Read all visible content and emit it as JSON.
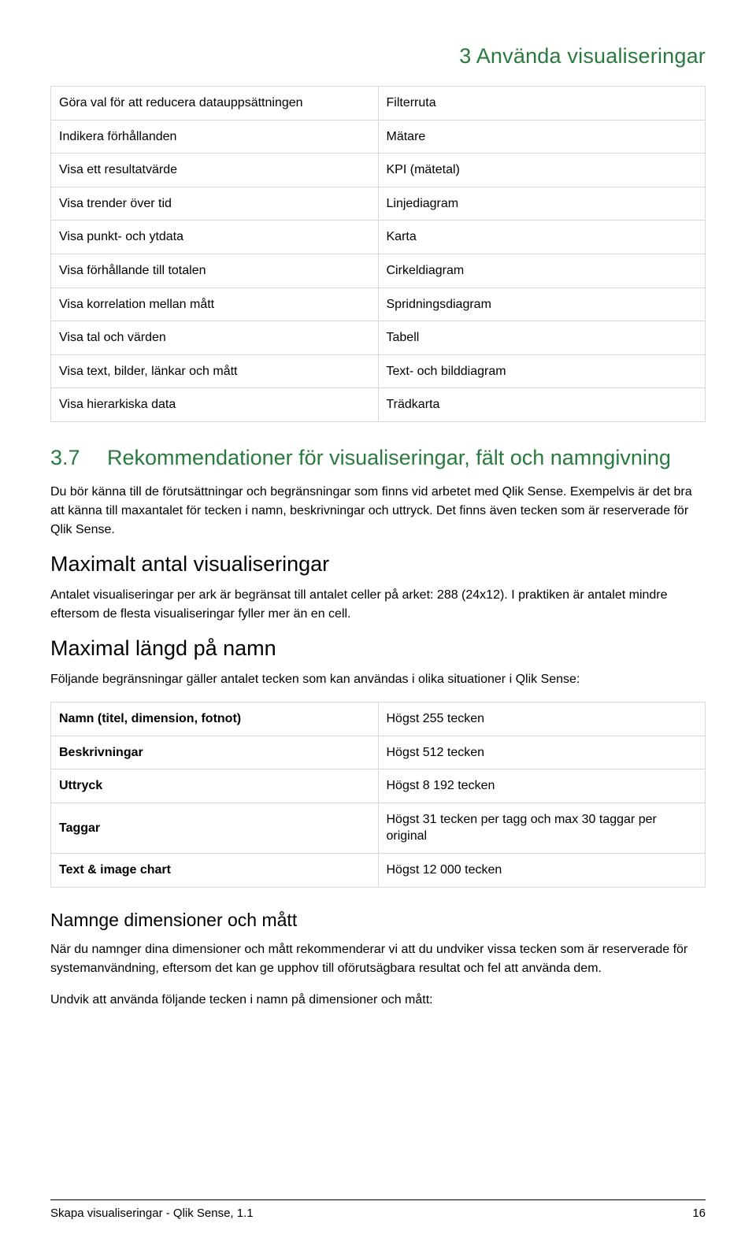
{
  "chapter_header": "3  Använda visualiseringar",
  "table1": {
    "rows": [
      {
        "left": "Göra val för att reducera datauppsättningen",
        "right": "Filterruta"
      },
      {
        "left": "Indikera förhållanden",
        "right": "Mätare"
      },
      {
        "left": "Visa ett resultatvärde",
        "right": "KPI (mätetal)"
      },
      {
        "left": "Visa trender över tid",
        "right": "Linjediagram"
      },
      {
        "left": "Visa punkt- och ytdata",
        "right": "Karta"
      },
      {
        "left": "Visa förhållande till totalen",
        "right": "Cirkeldiagram"
      },
      {
        "left": "Visa korrelation mellan mått",
        "right": "Spridningsdiagram"
      },
      {
        "left": "Visa tal och värden",
        "right": "Tabell"
      },
      {
        "left": "Visa text, bilder, länkar och mått",
        "right": "Text- och bilddiagram"
      },
      {
        "left": "Visa hierarkiska data",
        "right": "Trädkarta"
      }
    ]
  },
  "section_3_7": {
    "number": "3.7",
    "title": "Rekommendationer för visualiseringar, fält och namngivning",
    "para": "Du bör känna till de förutsättningar och begränsningar som finns vid arbetet med Qlik Sense. Exempelvis är det bra att känna till maxantalet för tecken i namn, beskrivningar och uttryck. Det finns även tecken som är reserverade för Qlik Sense."
  },
  "max_vis": {
    "heading": "Maximalt antal visualiseringar",
    "para": "Antalet visualiseringar per ark är begränsat till antalet celler på arket: 288 (24x12). I praktiken är antalet mindre eftersom de flesta visualiseringar fyller mer än en cell."
  },
  "max_len": {
    "heading": "Maximal längd på namn",
    "para": "Följande begränsningar gäller antalet tecken som kan användas i olika situationer i Qlik Sense:"
  },
  "table2": {
    "rows": [
      {
        "left": "Namn (titel, dimension, fotnot)",
        "right": "Högst 255 tecken",
        "bold": true
      },
      {
        "left": "Beskrivningar",
        "right": "Högst 512 tecken",
        "bold": true
      },
      {
        "left": "Uttryck",
        "right": "Högst 8 192 tecken",
        "bold": true
      },
      {
        "left": "Taggar",
        "right": "Högst 31 tecken per tagg och max 30 taggar per original",
        "bold": true
      },
      {
        "left": "Text & image chart",
        "right": "Högst 12 000 tecken",
        "bold": true
      }
    ]
  },
  "naming": {
    "heading": "Namnge dimensioner och mått",
    "para1": "När du namnger dina dimensioner och mått rekommenderar vi att du undviker vissa tecken som är reserverade för systemanvändning, eftersom det kan ge upphov till oförutsägbara resultat och fel att använda dem.",
    "para2": "Undvik att använda följande tecken i namn på dimensioner och mått:"
  },
  "footer": {
    "left": "Skapa visualiseringar - Qlik Sense, 1.1",
    "right": "16"
  }
}
